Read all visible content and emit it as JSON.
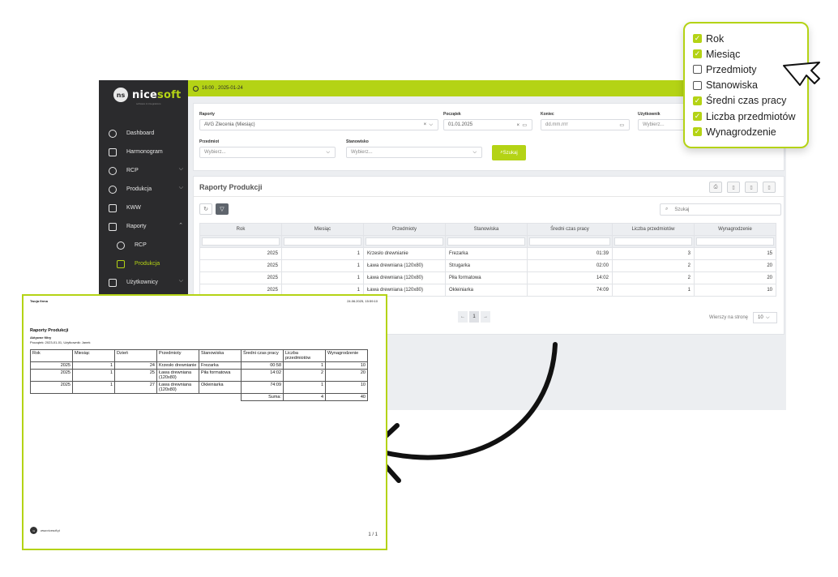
{
  "brand": {
    "name_part1": "nice",
    "name_part2": "soft",
    "badge": "ns",
    "tagline": "software & integrations"
  },
  "topbar": {
    "datetime": "16:00 , 2025-01-24"
  },
  "sidebar": {
    "items": [
      {
        "label": "Dashboard",
        "icon": "dashboard-icon"
      },
      {
        "label": "Harmonogram",
        "icon": "calendar-icon"
      },
      {
        "label": "RCP",
        "icon": "clock-icon",
        "chevron": "⌵"
      },
      {
        "label": "Produkcja",
        "icon": "cycle-icon",
        "chevron": "⌵"
      },
      {
        "label": "KWW",
        "icon": "checklist-icon"
      },
      {
        "label": "Raporty",
        "icon": "chart-icon",
        "chevron": "⌃"
      },
      {
        "label": "RCP",
        "icon": "clock-icon"
      },
      {
        "label": "Produkcja",
        "icon": "box-icon"
      },
      {
        "label": "Użytkownicy",
        "icon": "users-icon",
        "chevron": "⌵"
      }
    ]
  },
  "filters": {
    "raporty_label": "Raporty",
    "raporty_value": "AVG Zlecenia (Miesiąc)",
    "poczatek_label": "Początek",
    "poczatek_value": "01.01.2025",
    "koniec_label": "Koniec",
    "koniec_placeholder": "dd.mm.rrrr",
    "uzytkownik_label": "Użytkownik",
    "uzytkownik_placeholder": "Wybierz...",
    "przedmiot_label": "Przedmiot",
    "przedmiot_placeholder": "Wybierz...",
    "stanowisko_label": "Stanowisko",
    "stanowisko_placeholder": "Wybierz...",
    "search_button": "Szukaj"
  },
  "report": {
    "title": "Raporty Produkcji",
    "search_placeholder": "Szukaj",
    "columns": [
      "Rok",
      "Miesiąc",
      "Przedmioty",
      "Stanowiska",
      "Średni czas pracy",
      "Liczba przedmiotów",
      "Wynagrodzenie"
    ],
    "rows": [
      [
        "2025",
        "1",
        "Krzesło drewnianie",
        "Frezarka",
        "01:39",
        "3",
        "15"
      ],
      [
        "2025",
        "1",
        "Ława drewniana (120x80)",
        "Strugarka",
        "02:00",
        "2",
        "20"
      ],
      [
        "2025",
        "1",
        "Ława drewniana (120x80)",
        "Piła formatowa",
        "14:02",
        "2",
        "20"
      ],
      [
        "2025",
        "1",
        "Ława drewniana (120x80)",
        "Okleiniarka",
        "74:09",
        "1",
        "10"
      ]
    ],
    "pager": {
      "prev": "←",
      "page": "1",
      "next": "→"
    },
    "rows_per_page_label": "Wierszy na stronę",
    "rows_per_page_value": "10"
  },
  "column_chooser": [
    {
      "label": "Rok",
      "checked": true
    },
    {
      "label": "Miesiąc",
      "checked": true
    },
    {
      "label": "Przedmioty",
      "checked": false
    },
    {
      "label": "Stanowiska",
      "checked": false
    },
    {
      "label": "Średni czas pracy",
      "checked": true
    },
    {
      "label": "Liczba przedmiotów",
      "checked": true
    },
    {
      "label": "Wynagrodzenie",
      "checked": true
    }
  ],
  "pdf": {
    "company": "Twoja firma",
    "timestamp": "24.06.2025, 15:59:10",
    "title": "Raporty Produkcji",
    "filters_line1": "Aktywne filtry",
    "filters_line2": "Początek: 2023-01-01, Użytkownik: Janek",
    "columns": [
      "Rok",
      "Miesiąc",
      "Dzień",
      "Przedmioty",
      "Stanowiska",
      "Średni czas pracy",
      "Liczba przedmiotów",
      "Wynagrodzenie"
    ],
    "rows": [
      [
        "2025",
        "1",
        "24",
        "Krzesło drewnianie",
        "Frezarka",
        "00:58",
        "1",
        "10"
      ],
      [
        "2025",
        "1",
        "25",
        "Ława drewniana (120x80)",
        "Piła formatowa",
        "14:02",
        "2",
        "20"
      ],
      [
        "2025",
        "1",
        "27",
        "Ława drewniana (120x80)",
        "Okleiniarka",
        "74:09",
        "1",
        "10"
      ]
    ],
    "sum_label": "Suma:",
    "sum_count": "4",
    "sum_pay": "40",
    "footer_url": "www.nicesoft.pl",
    "page": "1 / 1"
  },
  "colors": {
    "accent": "#b4d315",
    "sidebar": "#2b2b2d"
  }
}
